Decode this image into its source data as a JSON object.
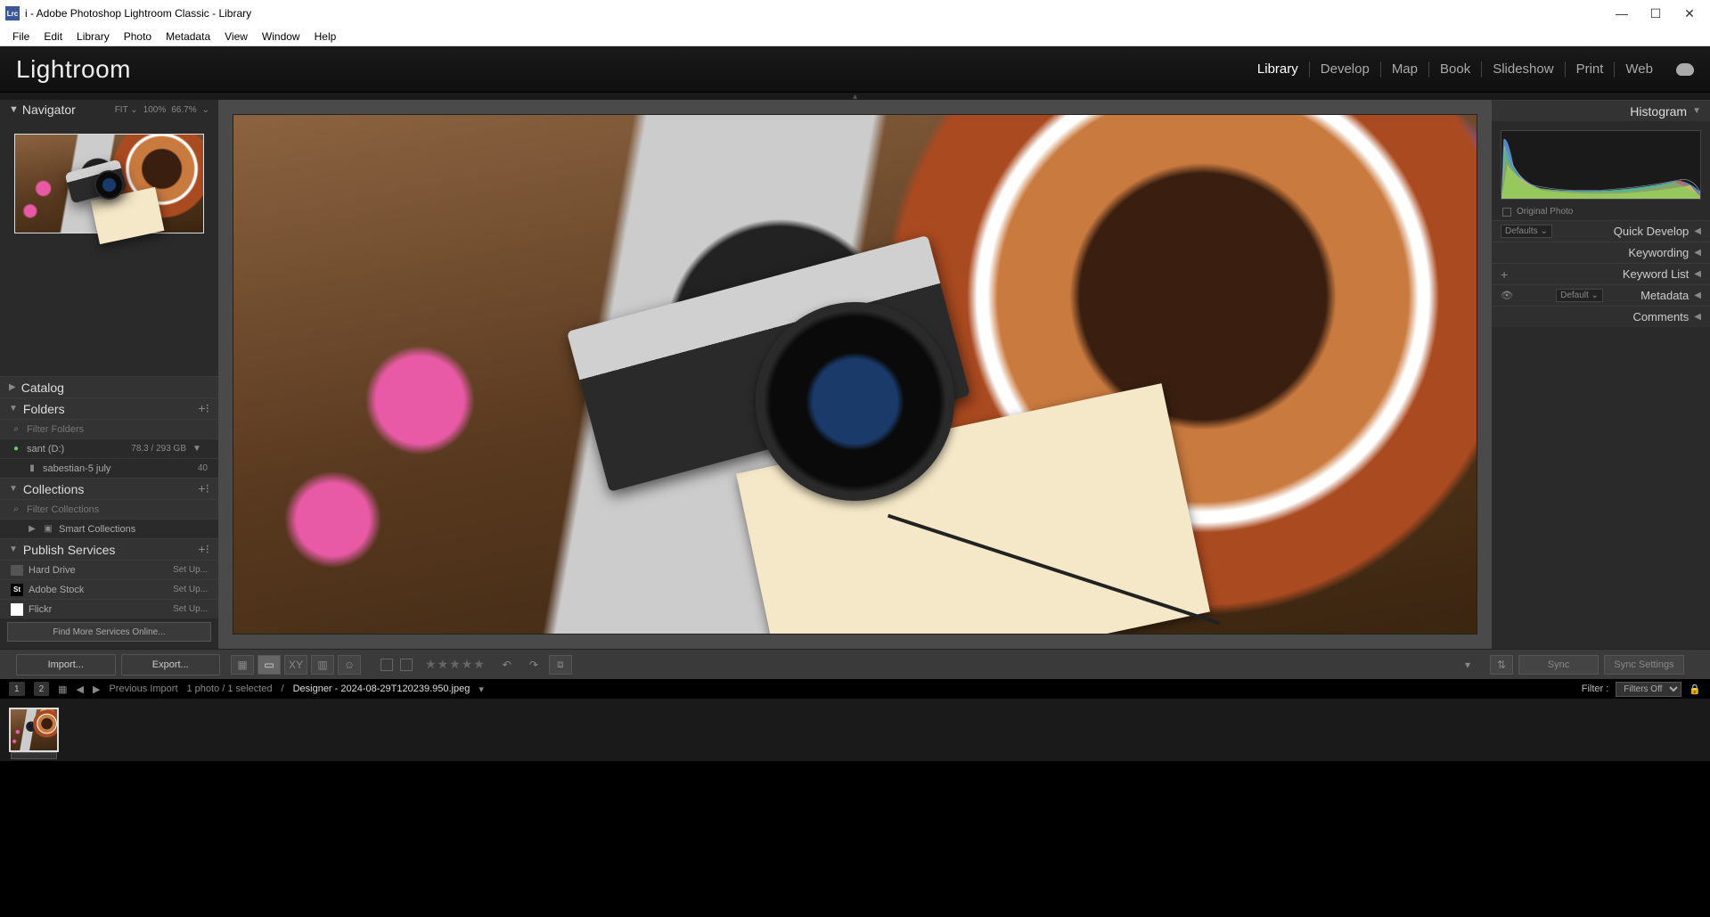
{
  "window": {
    "title": "i - Adobe Photoshop Lightroom Classic - Library",
    "logo": "Lrc"
  },
  "menu": [
    "File",
    "Edit",
    "Library",
    "Photo",
    "Metadata",
    "View",
    "Window",
    "Help"
  ],
  "brand": "Lightroom",
  "modules": [
    {
      "label": "Library",
      "active": true
    },
    {
      "label": "Develop",
      "active": false
    },
    {
      "label": "Map",
      "active": false
    },
    {
      "label": "Book",
      "active": false
    },
    {
      "label": "Slideshow",
      "active": false
    },
    {
      "label": "Print",
      "active": false
    },
    {
      "label": "Web",
      "active": false
    }
  ],
  "navigator": {
    "title": "Navigator",
    "fit": "FIT ⌄",
    "zoom1": "100%",
    "zoom2": "66.7%"
  },
  "left": {
    "catalog": "Catalog",
    "folders": "Folders",
    "filter_folders_ph": "Filter Folders",
    "drive": "sant (D:)",
    "drive_usage": "78.3 / 293 GB",
    "folder1": "sabestian-5 july",
    "folder1_count": "40",
    "collections": "Collections",
    "filter_coll_ph": "Filter Collections",
    "smart_coll": "Smart Collections",
    "publish": "Publish Services",
    "pub_items": [
      {
        "name": "Hard Drive",
        "action": "Set Up..."
      },
      {
        "name": "Adobe Stock",
        "action": "Set Up...",
        "badge": "St"
      },
      {
        "name": "Flickr",
        "action": "Set Up..."
      }
    ],
    "find_more": "Find More Services Online...",
    "import": "Import...",
    "export": "Export..."
  },
  "right": {
    "histogram": "Histogram",
    "orig": "Original Photo",
    "quick_dev": "Quick Develop",
    "quick_sel": "Defaults",
    "keywording": "Keywording",
    "keyword_list": "Keyword List",
    "metadata": "Metadata",
    "metadata_sel": "Default",
    "comments": "Comments",
    "sync": "Sync",
    "sync_settings": "Sync Settings"
  },
  "status": {
    "pill1": "1",
    "pill2": "2",
    "prev_import": "Previous Import",
    "count": "1 photo / 1 selected",
    "filename": "Designer - 2024-08-29T120239.950.jpeg",
    "filter_label": "Filter :",
    "filter_val": "Filters Off"
  }
}
